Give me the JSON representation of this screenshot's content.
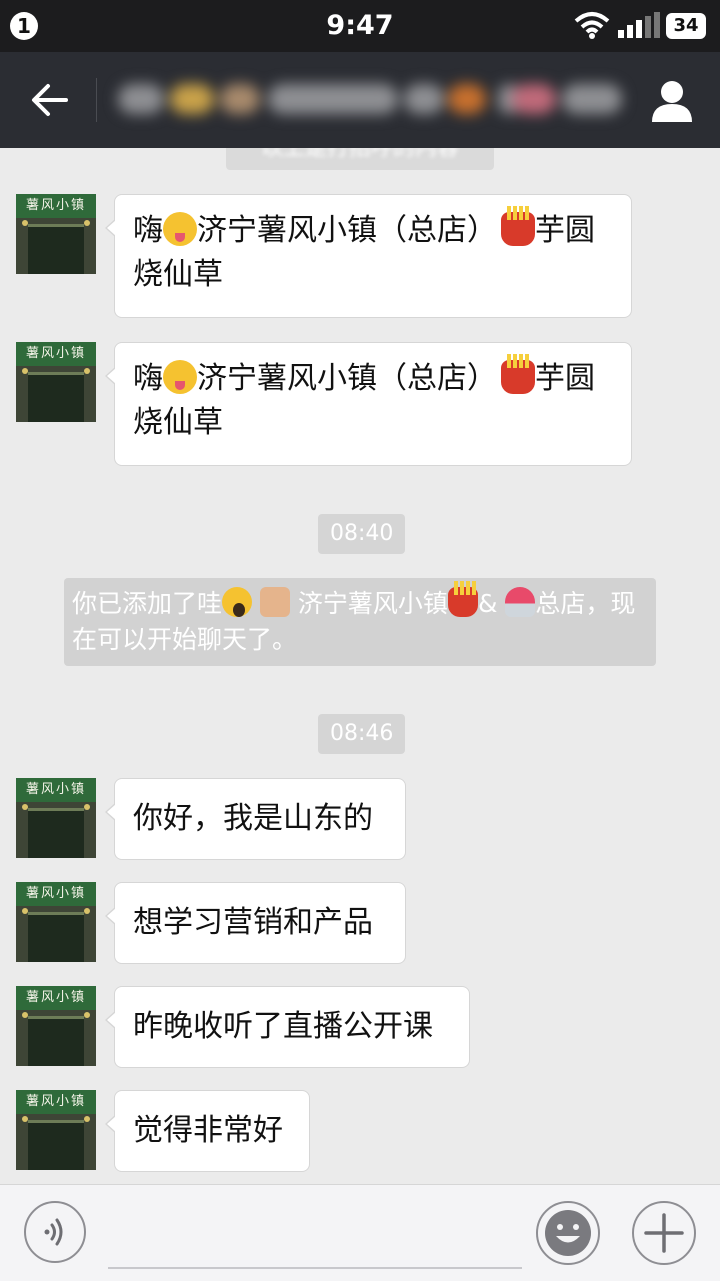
{
  "status_bar": {
    "notification_count": "1",
    "time": "9:47",
    "battery": "34"
  },
  "nav": {
    "back_icon": "back-arrow-icon",
    "title": "",
    "contact_icon": "person-icon"
  },
  "chat": {
    "messages": [
      {
        "sender": "济宁薯风小镇",
        "text_before": "嗨",
        "emoji1": "wink-tongue-emoji",
        "text_mid": "济宁薯风小镇（总店）",
        "emoji2": "fries-emoji",
        "text_after": "芋圆烧仙草"
      },
      {
        "sender": "济宁薯风小镇",
        "text_before": "嗨",
        "emoji1": "wink-tongue-emoji",
        "text_mid": "济宁薯风小镇（总店）",
        "emoji2": "fries-emoji",
        "text_after": "芋圆烧仙草"
      }
    ],
    "time_1": "08:40",
    "system_note": {
      "part1": "你已添加了哇",
      "part2": "济宁薯风小镇",
      "part3": "&",
      "part4": "总店，现在可以开始聊天了。"
    },
    "time_2": "08:46",
    "later_messages": [
      "你好，我是山东的",
      "想学习营销和产品",
      "昨晚收听了直播公开课",
      "觉得非常好"
    ],
    "avatar_sign_text": "薯风小镇"
  },
  "input_bar": {
    "voice_icon": "voice-icon",
    "emoji_icon": "emoji-face-icon",
    "plus_icon": "plus-icon"
  }
}
